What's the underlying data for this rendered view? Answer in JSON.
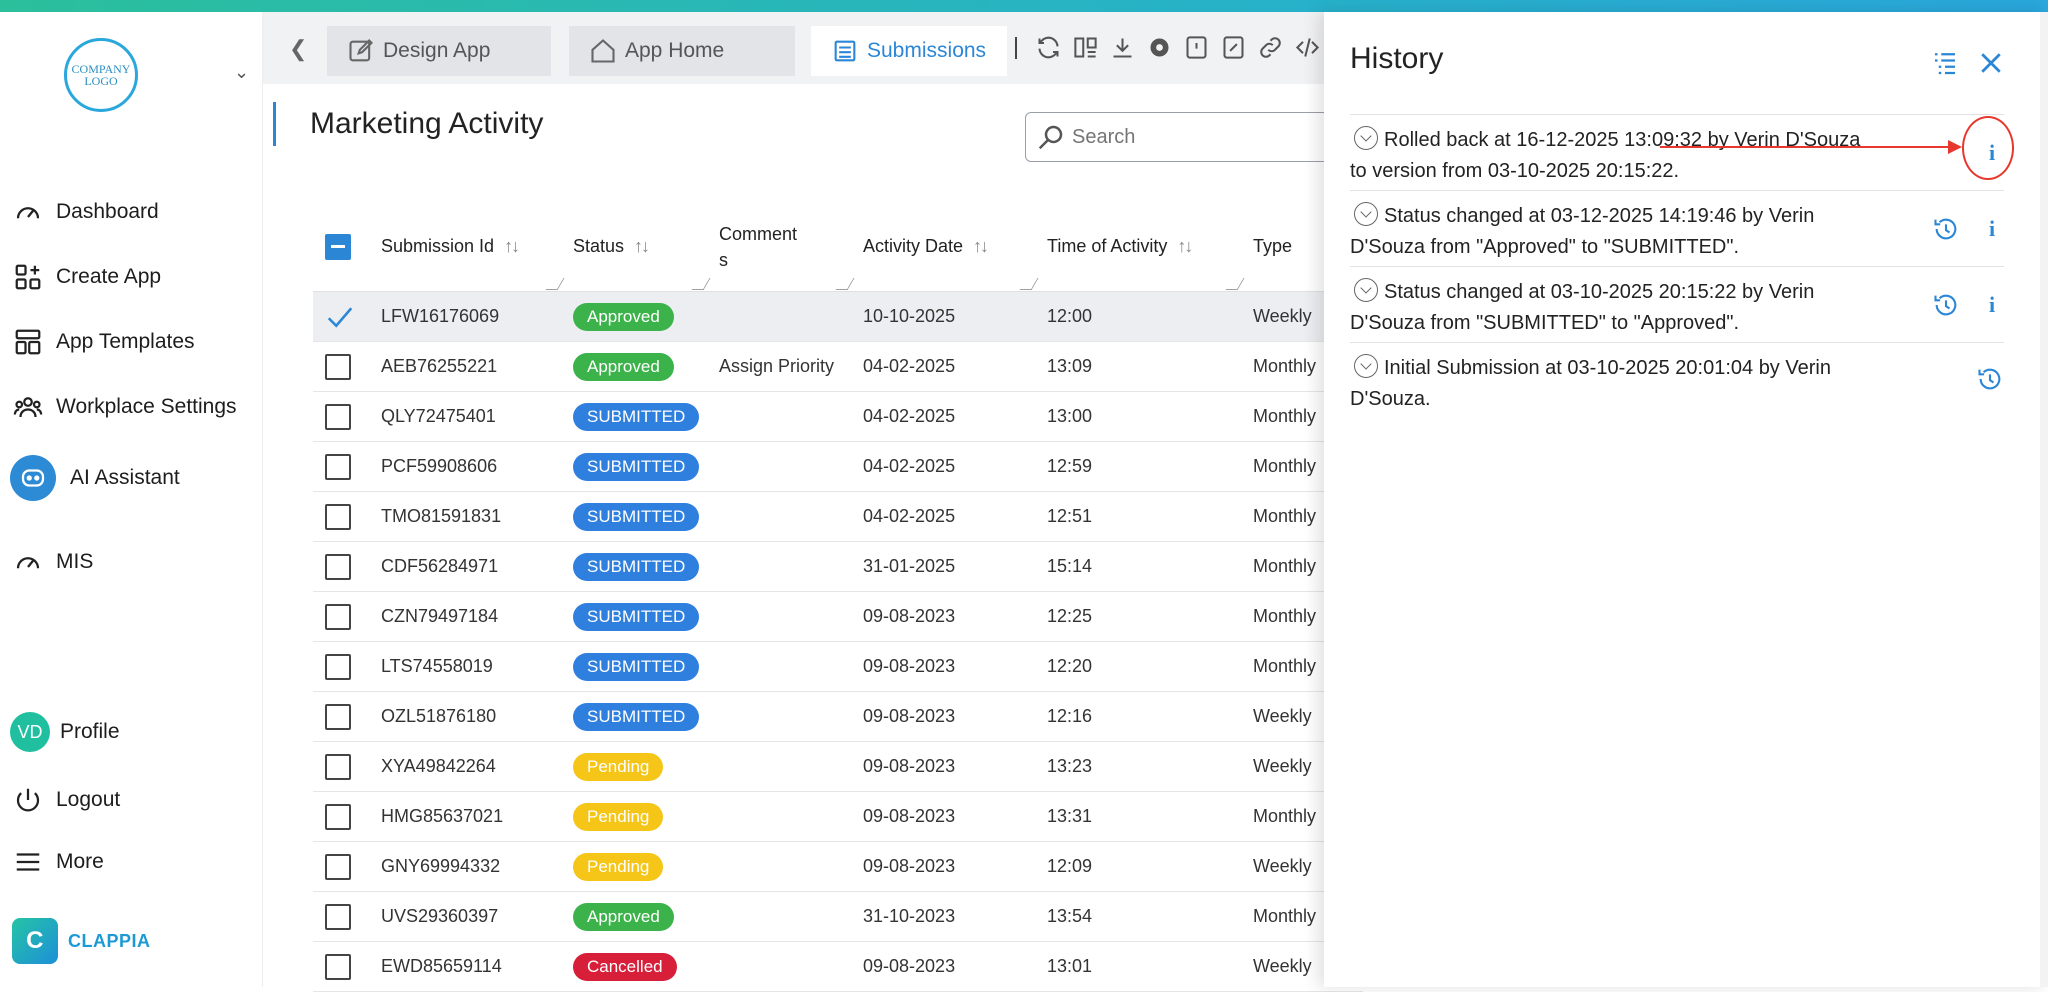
{
  "sidebar": {
    "logo_text": "COMPANY LOGO",
    "items": [
      {
        "label": "Dashboard",
        "icon": "gauge-icon"
      },
      {
        "label": "Create App",
        "icon": "grid-plus-icon"
      },
      {
        "label": "App Templates",
        "icon": "templates-icon"
      },
      {
        "label": "Workplace Settings",
        "icon": "users-icon"
      },
      {
        "label": "AI Assistant",
        "icon": "ai-bot-icon"
      },
      {
        "label": "MIS",
        "icon": "gauge-icon"
      }
    ],
    "profile": {
      "initials": "VD",
      "label": "Profile"
    },
    "logout_label": "Logout",
    "more_label": "More",
    "brand": "CLAPPIA"
  },
  "tabs": [
    {
      "label": "Design App",
      "icon": "edit-icon"
    },
    {
      "label": "App Home",
      "icon": "home-icon"
    },
    {
      "label": "Submissions",
      "icon": "list-icon",
      "active": true
    }
  ],
  "page": {
    "title": "Marketing Activity"
  },
  "search": {
    "placeholder": "Search"
  },
  "table": {
    "columns": [
      "Submission Id",
      "Status",
      "Comments",
      "Activity Date",
      "Time of Activity",
      "Type"
    ],
    "rows": [
      {
        "id": "LFW16176069",
        "status": "Approved",
        "comments": "",
        "date": "10-10-2025",
        "time": "12:00",
        "type": "Weekly",
        "selected": true
      },
      {
        "id": "AEB76255221",
        "status": "Approved",
        "comments": "Assign Priority",
        "date": "04-02-2025",
        "time": "13:09",
        "type": "Monthly"
      },
      {
        "id": "QLY72475401",
        "status": "SUBMITTED",
        "comments": "",
        "date": "04-02-2025",
        "time": "13:00",
        "type": "Monthly"
      },
      {
        "id": "PCF59908606",
        "status": "SUBMITTED",
        "comments": "",
        "date": "04-02-2025",
        "time": "12:59",
        "type": "Monthly"
      },
      {
        "id": "TMO81591831",
        "status": "SUBMITTED",
        "comments": "",
        "date": "04-02-2025",
        "time": "12:51",
        "type": "Monthly"
      },
      {
        "id": "CDF56284971",
        "status": "SUBMITTED",
        "comments": "",
        "date": "31-01-2025",
        "time": "15:14",
        "type": "Monthly"
      },
      {
        "id": "CZN79497184",
        "status": "SUBMITTED",
        "comments": "",
        "date": "09-08-2023",
        "time": "12:25",
        "type": "Monthly"
      },
      {
        "id": "LTS74558019",
        "status": "SUBMITTED",
        "comments": "",
        "date": "09-08-2023",
        "time": "12:20",
        "type": "Monthly"
      },
      {
        "id": "OZL51876180",
        "status": "SUBMITTED",
        "comments": "",
        "date": "09-08-2023",
        "time": "12:16",
        "type": "Weekly"
      },
      {
        "id": "XYA49842264",
        "status": "Pending",
        "comments": "",
        "date": "09-08-2023",
        "time": "13:23",
        "type": "Weekly"
      },
      {
        "id": "HMG85637021",
        "status": "Pending",
        "comments": "",
        "date": "09-08-2023",
        "time": "13:31",
        "type": "Monthly"
      },
      {
        "id": "GNY69994332",
        "status": "Pending",
        "comments": "",
        "date": "09-08-2023",
        "time": "12:09",
        "type": "Weekly"
      },
      {
        "id": "UVS29360397",
        "status": "Approved",
        "comments": "",
        "date": "31-10-2023",
        "time": "13:54",
        "type": "Monthly"
      },
      {
        "id": "EWD85659114",
        "status": "Cancelled",
        "comments": "",
        "date": "09-08-2023",
        "time": "13:01",
        "type": "Weekly"
      }
    ]
  },
  "history": {
    "title": "History",
    "entries": [
      {
        "text": "Rolled back at 16-12-2025 13:09:32 by Verin D'Souza to version from 03-10-2025 20:15:22.",
        "restore": false,
        "info": true
      },
      {
        "text": "Status changed at 03-12-2025 14:19:46 by Verin D'Souza from \"Approved\" to \"SUBMITTED\".",
        "restore": true,
        "info": true
      },
      {
        "text": "Status changed at 03-10-2025 20:15:22 by Verin D'Souza from \"SUBMITTED\" to \"Approved\".",
        "restore": true,
        "info": true
      },
      {
        "text": "Initial Submission at 03-10-2025 20:01:04 by Verin D'Souza.",
        "restore": true,
        "info": false
      }
    ]
  },
  "colors": {
    "accent": "#2b87d6",
    "approved": "#3bb34a",
    "submitted": "#2f7fde",
    "pending": "#f5c518",
    "cancelled": "#d81f3a",
    "annotation": "#e8372c"
  }
}
